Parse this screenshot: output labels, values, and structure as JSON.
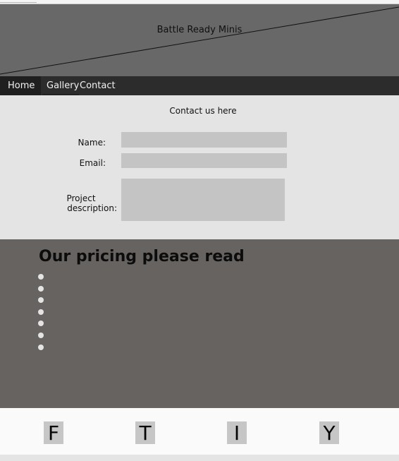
{
  "header": {
    "title": "Battle Ready Minis"
  },
  "nav": {
    "items": [
      {
        "label": "Home"
      },
      {
        "label": "Gallery"
      },
      {
        "label": "Contact"
      }
    ]
  },
  "contact": {
    "title": "Contact us here",
    "name_label": "Name:",
    "email_label": "Email:",
    "project_label_line1": "Project",
    "project_label_line2": "description:",
    "name_value": "",
    "email_value": "",
    "project_value": ""
  },
  "pricing": {
    "title": "Our pricing please read",
    "bullet_count": 7
  },
  "footer": {
    "social": [
      {
        "label": "F",
        "icon": "facebook-icon"
      },
      {
        "label": "T",
        "icon": "twitter-icon"
      },
      {
        "label": "I",
        "icon": "instagram-icon"
      },
      {
        "label": "Y",
        "icon": "youtube-icon"
      }
    ]
  },
  "colors": {
    "hero_bg": "#686868",
    "nav_bg": "#2c2c2c",
    "form_bg": "#e4e4e4",
    "field_bg": "#c4c4c4",
    "pricing_bg": "#676361",
    "footer_bg": "#fafafa"
  }
}
